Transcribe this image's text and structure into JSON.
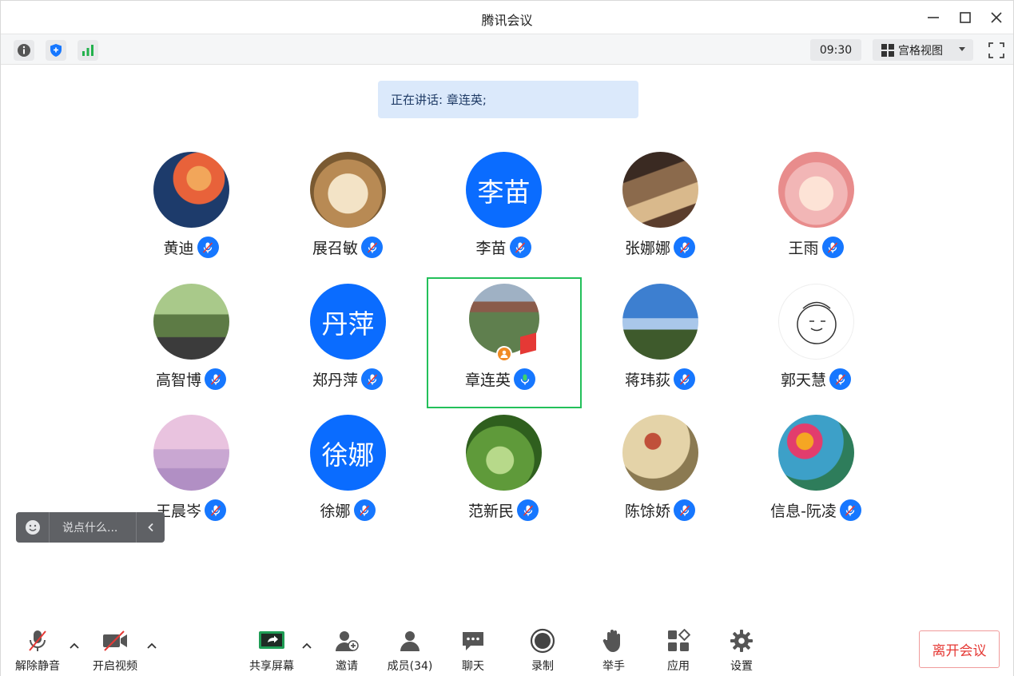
{
  "window": {
    "title": "腾讯会议"
  },
  "toolbar": {
    "clock": "09:30",
    "view_label": "宫格视图"
  },
  "speaking": {
    "text": "正在讲话: 章连英;"
  },
  "participants": [
    {
      "name": "黄迪",
      "avatar": "photo",
      "color": "#e8623a"
    },
    {
      "name": "展召敏",
      "avatar": "photo",
      "color": "#c9a46a"
    },
    {
      "name": "李苗",
      "avatar": "text",
      "initials": "李苗"
    },
    {
      "name": "张娜娜",
      "avatar": "photo",
      "color": "#6b4a3a"
    },
    {
      "name": "王雨",
      "avatar": "photo",
      "color": "#f2b6b6"
    },
    {
      "name": "高智博",
      "avatar": "photo",
      "color": "#6e8f5a"
    },
    {
      "name": "郑丹萍",
      "avatar": "text",
      "initials": "丹萍"
    },
    {
      "name": "章连英",
      "avatar": "photo",
      "color": "#7a8f6a",
      "speaking": true
    },
    {
      "name": "蒋玮荻",
      "avatar": "photo",
      "color": "#4d8bd6"
    },
    {
      "name": "郭天慧",
      "avatar": "photo",
      "color": "#ffffff"
    },
    {
      "name": "王晨岑",
      "avatar": "photo",
      "color": "#d9b7d6"
    },
    {
      "name": "徐娜",
      "avatar": "text",
      "initials": "徐娜"
    },
    {
      "name": "范新民",
      "avatar": "photo",
      "color": "#5f9a3a"
    },
    {
      "name": "陈馀娇",
      "avatar": "photo",
      "color": "#cdb88a"
    },
    {
      "name": "信息-阮凌",
      "avatar": "photo",
      "color": "#3da0c8"
    }
  ],
  "chat": {
    "placeholder": "说点什么..."
  },
  "bottom": {
    "unmute": "解除静音",
    "video": "开启视频",
    "share": "共享屏幕",
    "invite": "邀请",
    "members": "成员(34)",
    "chat": "聊天",
    "record": "录制",
    "raise_hand": "举手",
    "apps": "应用",
    "settings": "设置",
    "leave": "离开会议"
  },
  "colors": {
    "accent": "#1677ff",
    "speaking_border": "#23c05a",
    "leave": "#e53935"
  }
}
